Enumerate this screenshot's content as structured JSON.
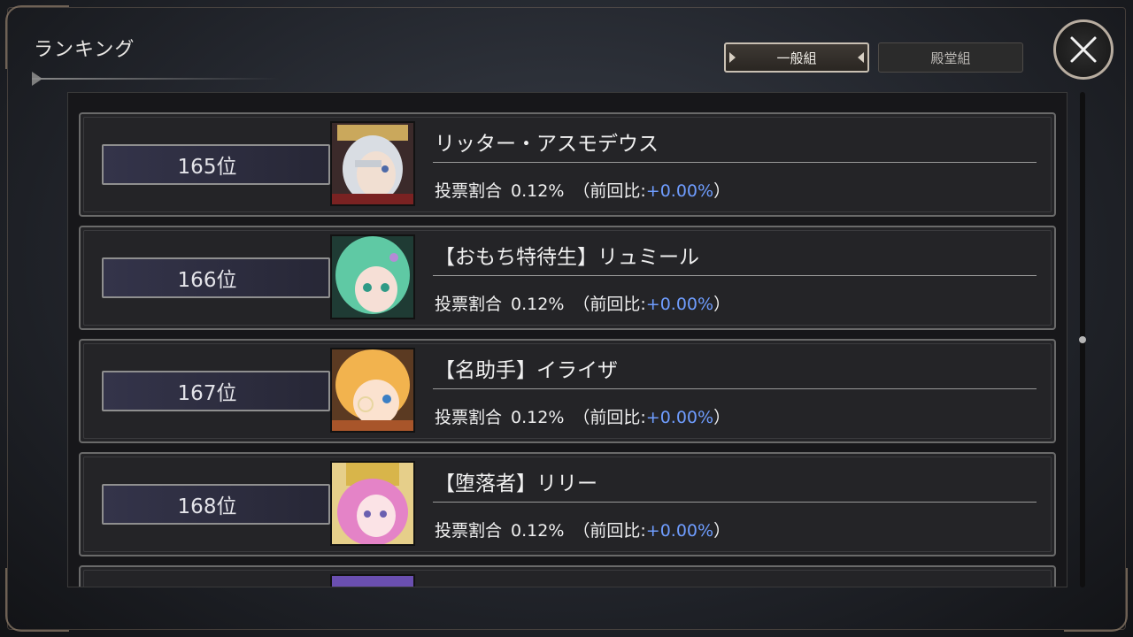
{
  "window": {
    "title": "ランキング"
  },
  "tabs": [
    {
      "label": "一般組",
      "active": true
    },
    {
      "label": "殿堂組",
      "active": false
    }
  ],
  "close_icon": "close-x-icon",
  "colors": {
    "accent_change": "#6f9dff",
    "panel_bg": "#17171a",
    "rank_plate": "#34344a"
  },
  "entries": [
    {
      "rank": "165位",
      "name": "リッター・アスモデウス",
      "vote_label": "投票割合",
      "vote_value": "0.12%",
      "prev_label": "（前回比:",
      "prev_value": "+0.00%",
      "prev_close": "）",
      "portrait": "white-haired-knight-portrait"
    },
    {
      "rank": "166位",
      "name": "【おもち特待生】リュミール",
      "vote_label": "投票割合",
      "vote_value": "0.12%",
      "prev_label": "（前回比:",
      "prev_value": "+0.00%",
      "prev_close": "）",
      "portrait": "green-haired-girl-portrait"
    },
    {
      "rank": "167位",
      "name": "【名助手】イライザ",
      "vote_label": "投票割合",
      "vote_value": "0.12%",
      "prev_label": "（前回比:",
      "prev_value": "+0.00%",
      "prev_close": "）",
      "portrait": "blonde-assistant-portrait"
    },
    {
      "rank": "168位",
      "name": "【堕落者】リリー",
      "vote_label": "投票割合",
      "vote_value": "0.12%",
      "prev_label": "（前回比:",
      "prev_value": "+0.00%",
      "prev_close": "）",
      "portrait": "pink-haired-nun-portrait"
    }
  ]
}
